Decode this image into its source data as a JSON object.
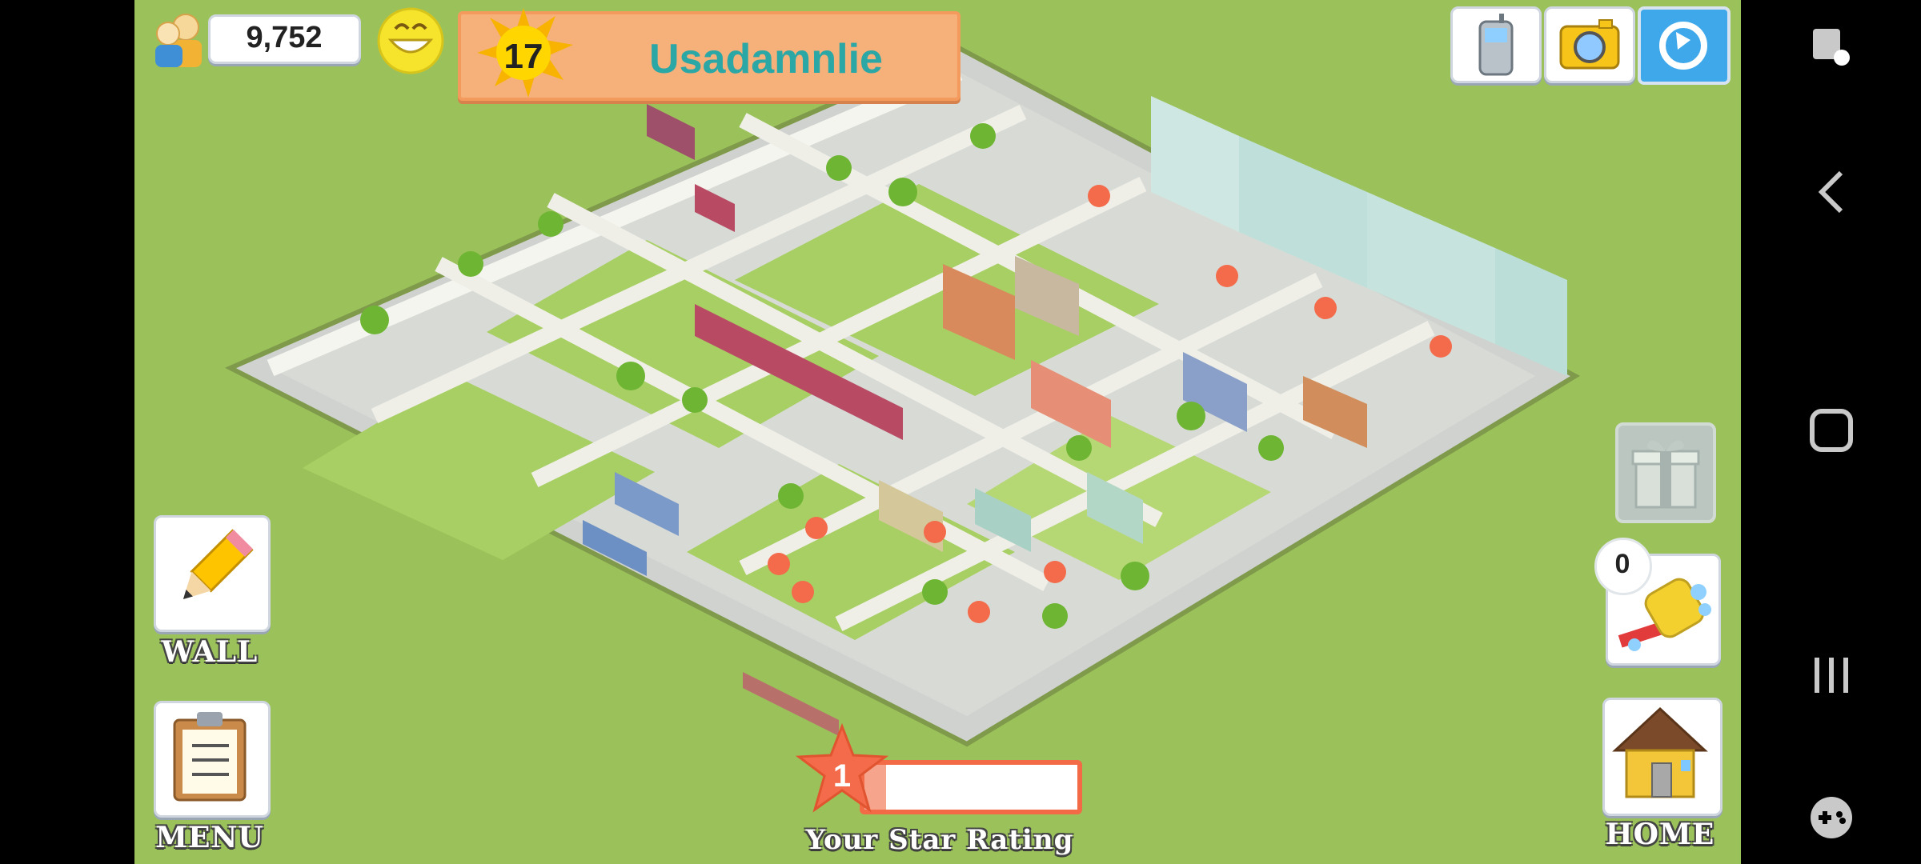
{
  "hud": {
    "population": "9,752",
    "level": "17",
    "city_name": "Usadamnlie",
    "star_rating_value": "1",
    "star_rating_progress": 0.1,
    "star_rating_label": "Your Star Rating",
    "gift_count": "0"
  },
  "buttons": {
    "wall": "WALL",
    "menu": "MENU",
    "home": "HOME"
  },
  "icons": {
    "population": "people-icon",
    "happiness": "smiley-face-icon",
    "level": "sun-icon",
    "phone": "cell-phone-icon",
    "camera": "camera-icon",
    "share": "share-icon",
    "gift": "gift-icon",
    "bulldozer": "bulldozer-icon",
    "wall": "pencil-icon",
    "menu": "clipboard-icon",
    "home": "house-icon"
  },
  "colors": {
    "grass": "#9bc25a",
    "city_name": "#2ba7a6",
    "banner": "#f6b07a",
    "star": "#f36b4b"
  }
}
